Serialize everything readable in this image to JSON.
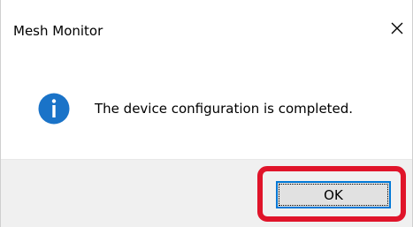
{
  "window": {
    "title": "Mesh Monitor",
    "close_icon": "close-icon"
  },
  "message": {
    "icon": "info-icon",
    "text": "The device configuration is completed."
  },
  "footer": {
    "ok_label": "OK"
  },
  "colors": {
    "info_icon": "#1a73c8",
    "highlight": "#e0142a",
    "button_border": "#0078d7",
    "footer_bg": "#f0f0f0"
  }
}
